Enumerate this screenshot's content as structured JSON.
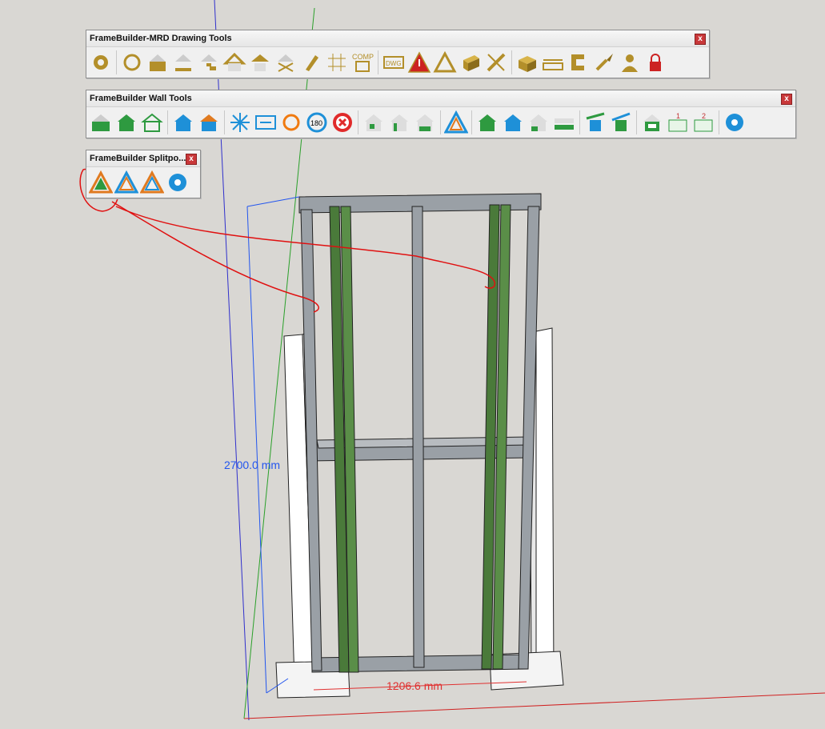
{
  "toolbars": {
    "drawing": {
      "title": "FrameBuilder-MRD Drawing Tools",
      "close": "x",
      "icons": [
        "settings-gear-icon",
        "refresh-icon",
        "wall-cladding-icon",
        "house-base-icon",
        "house-stairs-icon",
        "house-roof-icon",
        "roof-truss-icon",
        "cross-bracing-icon",
        "pencil-icon",
        "grid-icon",
        "comp-report-icon",
        "dwg-export-icon",
        "warning-triangle-icon",
        "triangle-frame-icon",
        "gold-box-icon",
        "tools-pencil-icon",
        "package-box-icon",
        "measure-icon",
        "clamp-icon",
        "brush-icon",
        "user-icon",
        "lock-icon"
      ]
    },
    "wall": {
      "title": "FrameBuilder Wall Tools",
      "close": "x",
      "icons": [
        "wall-green-icon",
        "house-green-icon",
        "greenhouse-icon",
        "house-blue-icon",
        "house-window-icon",
        "expand-arrows-icon",
        "resize-icon",
        "orange-refresh-icon",
        "rotate-180-icon",
        "delete-x-icon",
        "wall-opening-icon",
        "house-door-icon",
        "house-window-opening-icon",
        "blue-triangle-icon",
        "house-green-stairs-icon",
        "house-blue-stairs-icon",
        "house-partial-icon",
        "wall-base-icon",
        "roof-lean-icon",
        "roof-lean-blue-icon",
        "wall-panel-icon",
        "wall-grid-1-icon",
        "wall-grid-2-icon",
        "blue-gear-icon"
      ],
      "comp_label": "COMP",
      "dwg_label": "DWG",
      "rotate_label": "180",
      "grid1_label": "1",
      "grid2_label": "2"
    },
    "splitpost": {
      "title": "FrameBuilder Splitpo...",
      "close": "x",
      "icons": [
        "splitpost-green-icon",
        "splitpost-blue-icon",
        "splitpost-orange-icon",
        "splitpost-settings-icon"
      ]
    }
  },
  "dimensions": {
    "height": "2700.0 mm",
    "width": "1206.6 mm"
  },
  "colors": {
    "background": "#d9d7d3",
    "frame": "#9aa0a6",
    "splitpost": "#4a7a3a",
    "dimension_blue": "#2255ee",
    "dimension_red": "#e03030",
    "annotation_red": "#e01010"
  }
}
